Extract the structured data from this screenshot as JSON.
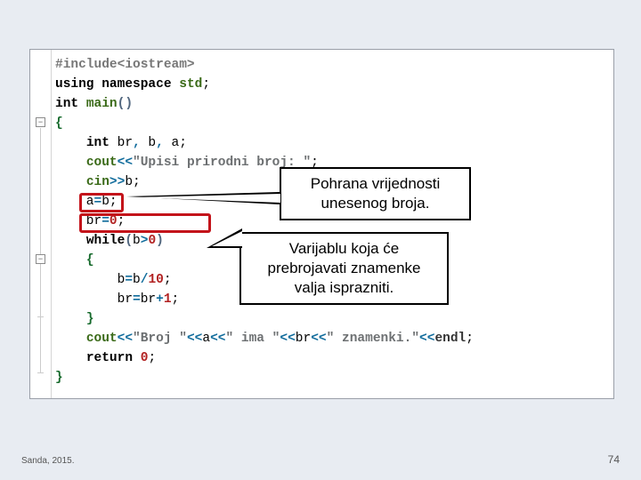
{
  "code": {
    "lines": [
      {
        "html": "<span class='pp'>#include&lt;iostream&gt;</span>"
      },
      {
        "html": "<span class='k'>using</span> <span class='k'>namespace</span> <span class='fn'>std</span>;"
      },
      {
        "html": "<span class='k'>int</span> <span class='fn'>main</span><span class='pr'>()</span>"
      },
      {
        "html": "<span class='br'>{</span>"
      },
      {
        "html": "    <span class='k'>int</span> br<span class='op'>,</span> b<span class='op'>,</span> a;"
      },
      {
        "html": "    <span class='fn'>cout</span><span class='op'>&lt;&lt;</span><span class='str'>\"Upisi prirodni broj: \"</span>;"
      },
      {
        "html": "    <span class='fn'>cin</span><span class='op'>&gt;&gt;</span>b;"
      },
      {
        "html": "    a<span class='op'>=</span>b;"
      },
      {
        "html": "    br<span class='op'>=</span><span class='nm'>0</span>;"
      },
      {
        "html": "    <span class='k'>while</span><span class='pr'>(</span>b<span class='op'>&gt;</span><span class='nm'>0</span><span class='pr'>)</span>"
      },
      {
        "html": "    <span class='br'>{</span>"
      },
      {
        "html": "        b<span class='op'>=</span>b<span class='op'>/</span><span class='nm'>10</span>;"
      },
      {
        "html": "        br<span class='op'>=</span>br<span class='op'>+</span><span class='nm'>1</span>;"
      },
      {
        "html": "    <span class='br'>}</span>"
      },
      {
        "html": "    <span class='fn'>cout</span><span class='op'>&lt;&lt;</span><span class='str'>\"Broj \"</span><span class='op'>&lt;&lt;</span>a<span class='op'>&lt;&lt;</span><span class='str'>\" ima \"</span><span class='op'>&lt;&lt;</span>br<span class='op'>&lt;&lt;</span><span class='str'>\" znamenki.\"</span><span class='op'>&lt;&lt;</span><span class='endl'>endl</span>;"
      },
      {
        "html": "    <span class='k'>return</span> <span class='nm'>0</span>;"
      },
      {
        "html": "<span class='br'>}</span>"
      }
    ]
  },
  "callouts": {
    "top_line1": "Pohrana vrijednosti",
    "top_line2": "unesenog broja.",
    "bot_line1": "Varijablu koja će",
    "bot_line2": "prebrojavati znamenke",
    "bot_line3": "valja isprazniti."
  },
  "footer": {
    "author": "Sanda, 2015.",
    "page": "74"
  }
}
